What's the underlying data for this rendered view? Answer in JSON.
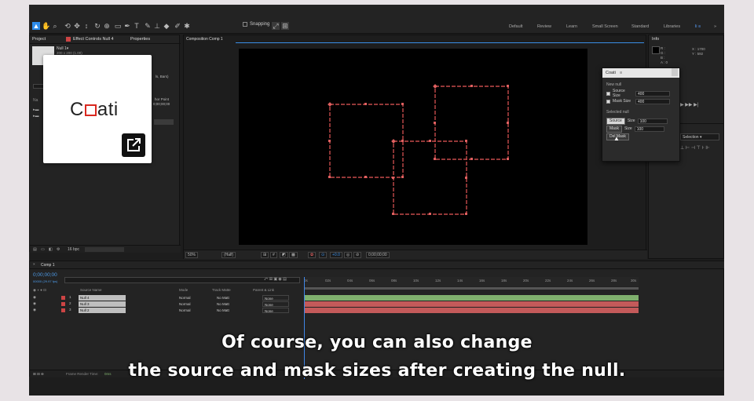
{
  "toolbar": {
    "snapping_label": "Snapping",
    "workspaces": [
      "Default",
      "Review",
      "Learn",
      "Small Screen",
      "Standard",
      "Libraries"
    ],
    "active_workspace_index": 6,
    "expand_glyph": "»"
  },
  "left_panel": {
    "tab_project": "Project",
    "tab_effect_controls": "Effect Controls Null 4",
    "tab_properties": "Properties",
    "null_name": "Null 1▾",
    "null_size": "200 x 200 (1.00)",
    "frag_right_1": "ls, Bars)",
    "frag_right_2": "hor Point",
    "frag_right_3": "0;00;00;00",
    "bit_depth": "16 bpc"
  },
  "coati": {
    "brand_pre": "C",
    "brand_post": "ati",
    "link_icon": "external-link-icon"
  },
  "viewer": {
    "tab": "Composition Comp 1",
    "zoom": "50%",
    "resolution": "(Half)",
    "timecode": "0;00;00;00",
    "accent": "#3a8ee6",
    "shape_color": "#ff7a7a"
  },
  "right_panel": {
    "tab_info": "Info",
    "r_label": "R :",
    "g_label": "G :",
    "b_label": "B :",
    "a_label": "A : 0",
    "x_label": "X : 1700",
    "y_label": "Y : 592",
    "selection_label": "Selection"
  },
  "dialog": {
    "title": "Coati",
    "new_null_label": "New null",
    "source_size_label": "Source Size",
    "source_size_value": "400",
    "mask_size_label": "Mask Size",
    "mask_size_value": "400",
    "selected_null_label": "Selected null",
    "source_button": "Source",
    "mask_button": "Mask",
    "size_label": "Size",
    "source_sel_value": "100",
    "mask_sel_value": "100",
    "del_mask_button": "Del Mask"
  },
  "timeline": {
    "tab": "Comp 1",
    "timecode": "0;00;00;00",
    "frames": "00000 (29.97 fps)",
    "col_source_name": "Source Name",
    "col_mode": "Mode",
    "col_track_matte": "Track Matte",
    "col_parent": "Parent & Link",
    "ticks": [
      "0s",
      "02s",
      "04s",
      "06s",
      "08s",
      "10s",
      "12s",
      "14s",
      "16s",
      "18s",
      "20s",
      "22s",
      "24s",
      "26s",
      "28s",
      "30s"
    ],
    "layers": [
      {
        "num": "1",
        "name": "Null 4",
        "mode": "Normal",
        "track": "No Matt",
        "parent": "None",
        "bar_color": "#7fb06d"
      },
      {
        "num": "2",
        "name": "Null 3",
        "mode": "Normal",
        "track": "No Matt",
        "parent": "None",
        "bar_color": "#c45a5a"
      },
      {
        "num": "3",
        "name": "Null 2",
        "mode": "Normal",
        "track": "No Matt",
        "parent": "None",
        "bar_color": "#c45a5a"
      }
    ],
    "status_label": "Frame Render Time:",
    "status_value": "0ms"
  },
  "subtitle": {
    "line1": "Of course, you can also change",
    "line2": "the source and mask sizes after creating the null."
  }
}
